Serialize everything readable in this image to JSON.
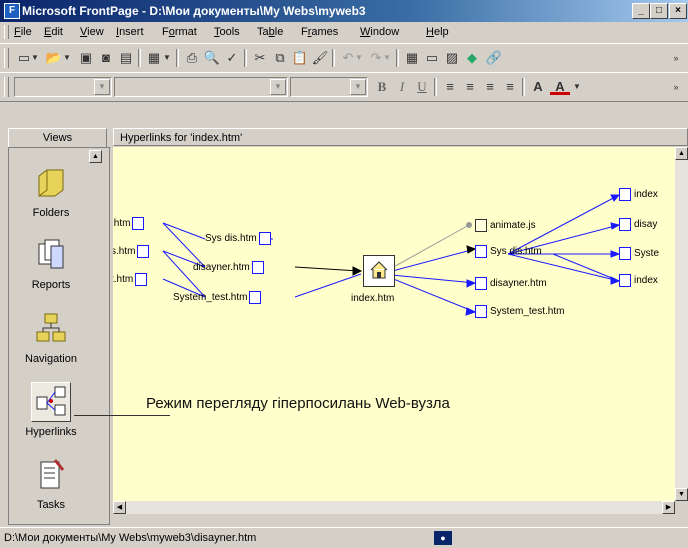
{
  "window": {
    "title": "Microsoft FrontPage - D:\\Мои документы\\My Webs\\myweb3",
    "controls": [
      "_",
      "□",
      "×"
    ]
  },
  "menu": [
    {
      "key": "F",
      "rest": "ile"
    },
    {
      "key": "E",
      "rest": "dit"
    },
    {
      "key": "V",
      "rest": "iew"
    },
    {
      "key": "I",
      "rest": "nsert"
    },
    {
      "key": "o",
      "pre": "F",
      "rest": "rmat"
    },
    {
      "key": "T",
      "rest": "ools"
    },
    {
      "key": "b",
      "pre": "Ta",
      "rest": "le"
    },
    {
      "key": "r",
      "pre": "F",
      "rest": "ames"
    },
    {
      "key": "W",
      "rest": "indow"
    },
    {
      "key": "H",
      "rest": "elp"
    }
  ],
  "format_toolbar": {
    "bold": "B",
    "italic": "I",
    "underline": "U"
  },
  "views": {
    "header": "Views",
    "items": [
      {
        "label": "Folders",
        "icon": "folder-icon"
      },
      {
        "label": "Reports",
        "icon": "reports-icon"
      },
      {
        "label": "Navigation",
        "icon": "navigation-icon"
      },
      {
        "label": "Hyperlinks",
        "icon": "hyperlinks-icon"
      },
      {
        "label": "Tasks",
        "icon": "tasks-icon"
      }
    ]
  },
  "content": {
    "header": "Hyperlinks for 'index.htm'",
    "center": "index.htm",
    "left_inbound": [
      "Sys dis.htm",
      "disayner.htm",
      "System_test.htm"
    ],
    "left_outer": [
      ".htm",
      "s.htm",
      "t.htm"
    ],
    "right_outbound": [
      "animate.js",
      "Sys dis.htm",
      "disayner.htm",
      "System_test.htm"
    ],
    "right_outer": [
      "index",
      "disay",
      "Syste",
      "index"
    ]
  },
  "annotation": "Режим перегляду гіперпосилань Web-вузла",
  "status": {
    "path": "D:\\Мои документы\\My Webs\\myweb3\\disayner.htm"
  },
  "colors": {
    "link": "#1a1aff",
    "canvas": "#ffffcc",
    "face": "#d4d0c8"
  }
}
